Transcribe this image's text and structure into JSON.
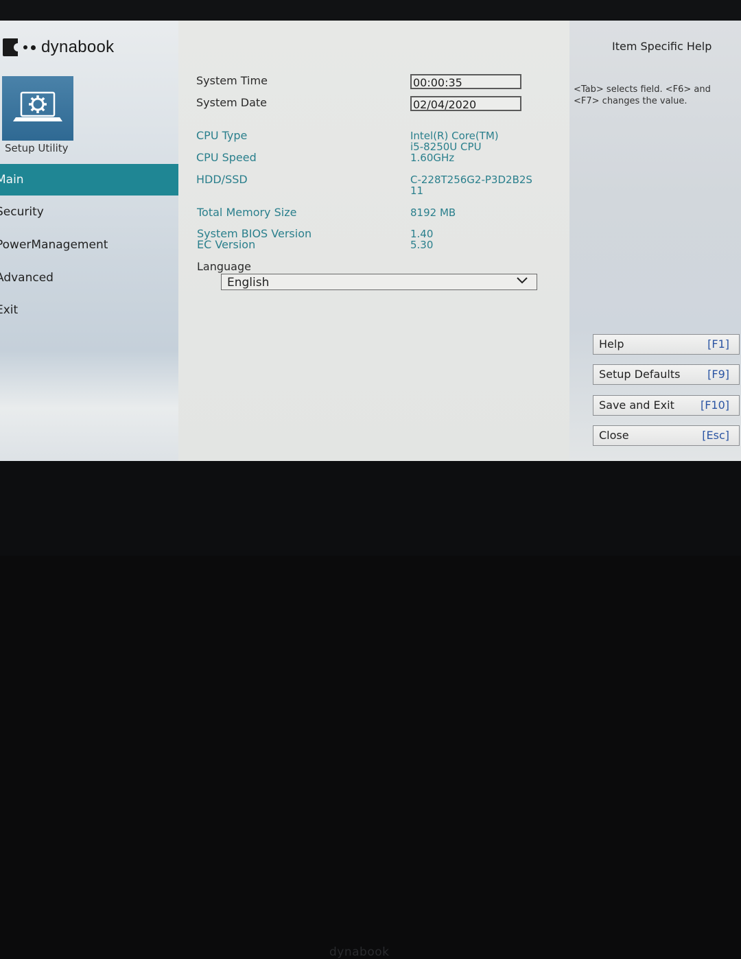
{
  "brand": {
    "name": "dynabook"
  },
  "sidebar": {
    "setup_label": "Setup Utility",
    "setup_icon": "gear-laptop-icon",
    "items": [
      {
        "label": "Main",
        "active": true
      },
      {
        "label": "Security",
        "active": false
      },
      {
        "label": "PowerManagement",
        "active": false
      },
      {
        "label": "Advanced",
        "active": false
      },
      {
        "label": "Exit",
        "active": false
      }
    ]
  },
  "main": {
    "system_time": {
      "label": "System Time",
      "value": "00:00:35"
    },
    "system_date": {
      "label": "System Date",
      "value": "02/04/2020"
    },
    "cpu_type": {
      "label": "CPU Type",
      "value_line1": "Intel(R) Core(TM)",
      "value_line2": "i5-8250U CPU"
    },
    "cpu_speed": {
      "label": "CPU Speed",
      "value": "1.60GHz"
    },
    "hdd": {
      "label": "HDD/SSD",
      "value_line1": "C-228T256G2-P3D2B2S",
      "value_line2": "11"
    },
    "memory": {
      "label": "Total Memory Size",
      "value": "8192 MB"
    },
    "bios": {
      "label": "System BIOS Version",
      "value": "1.40"
    },
    "ec": {
      "label": "EC Version",
      "value": "5.30"
    },
    "language": {
      "label": "Language",
      "value": "English"
    }
  },
  "help": {
    "title": "Item Specific Help",
    "text": "<Tab> selects field. <F6> and <F7> changes the value.",
    "buttons": [
      {
        "label": "Help",
        "key": "[F1]"
      },
      {
        "label": "Setup Defaults",
        "key": "[F9]"
      },
      {
        "label": "Save and Exit",
        "key": "[F10]"
      },
      {
        "label": "Close",
        "key": "[Esc]"
      }
    ]
  },
  "colors": {
    "accent": "#1f8694",
    "value_text": "#2a7f8c",
    "key_text": "#2b55a3"
  }
}
